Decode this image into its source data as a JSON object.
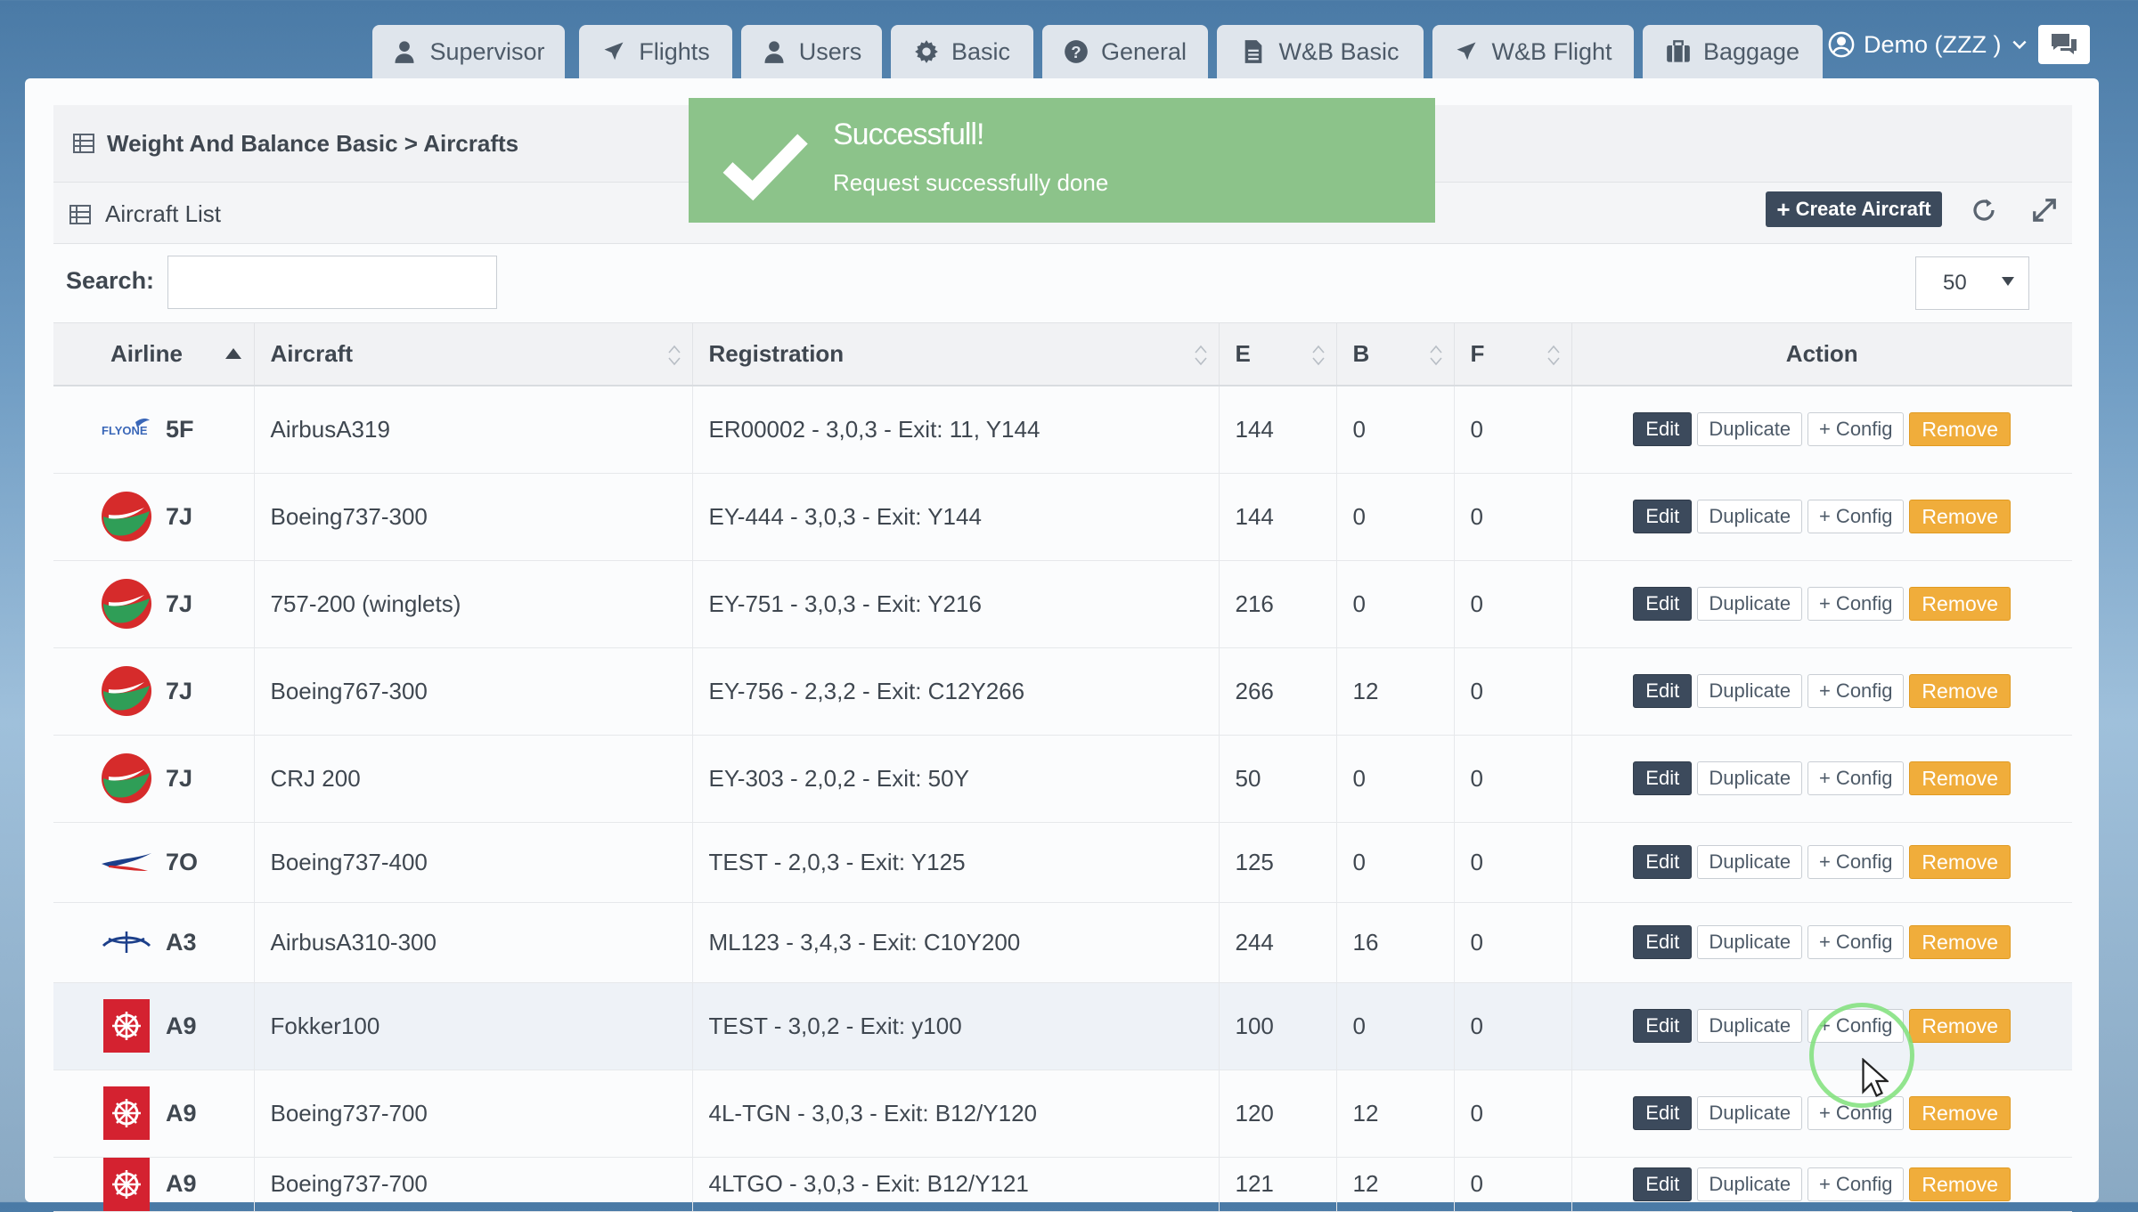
{
  "nav": {
    "tabs": [
      {
        "label": "Supervisor",
        "icon": "user-icon"
      },
      {
        "label": "Flights",
        "icon": "plane-icon"
      },
      {
        "label": "Users",
        "icon": "user-icon"
      },
      {
        "label": "Basic",
        "icon": "gear-icon"
      },
      {
        "label": "General",
        "icon": "question-icon"
      },
      {
        "label": "W&B Basic",
        "icon": "document-icon"
      },
      {
        "label": "W&B Flight",
        "icon": "plane-icon"
      },
      {
        "label": "Baggage",
        "icon": "suitcase-icon"
      }
    ],
    "user_label": "Demo (ZZZ )",
    "chat_icon": "chat-icon"
  },
  "breadcrumb": "Weight And Balance Basic > Aircrafts",
  "list": {
    "title": "Aircraft List",
    "create_label": "Create Aircraft"
  },
  "search": {
    "label": "Search:",
    "value": "",
    "placeholder": ""
  },
  "page_size": "50",
  "toast": {
    "title": "Successfull!",
    "message": "Request successfully done"
  },
  "table": {
    "columns": [
      "Airline",
      "Aircraft",
      "Registration",
      "E",
      "B",
      "F",
      "Action"
    ],
    "actions": {
      "edit": "Edit",
      "duplicate": "Duplicate",
      "config": "+ Config",
      "remove": "Remove"
    },
    "rows": [
      {
        "airline": "5F",
        "logo": "flyone-logo",
        "aircraft": "AirbusA319",
        "registration": "ER00002 - 3,0,3 - Exit: 11, Y144",
        "e": "144",
        "b": "0",
        "f": "0"
      },
      {
        "airline": "7J",
        "logo": "tajik-air-logo",
        "aircraft": "Boeing737-300",
        "registration": "EY-444 - 3,0,3 - Exit: Y144",
        "e": "144",
        "b": "0",
        "f": "0"
      },
      {
        "airline": "7J",
        "logo": "tajik-air-logo",
        "aircraft": "757-200 (winglets)",
        "registration": "EY-751 - 3,0,3 - Exit: Y216",
        "e": "216",
        "b": "0",
        "f": "0"
      },
      {
        "airline": "7J",
        "logo": "tajik-air-logo",
        "aircraft": "Boeing767-300",
        "registration": "EY-756 - 2,3,2 - Exit: C12Y266",
        "e": "266",
        "b": "12",
        "f": "0"
      },
      {
        "airline": "7J",
        "logo": "tajik-air-logo",
        "aircraft": "CRJ 200",
        "registration": "EY-303 - 2,0,2 - Exit: 50Y",
        "e": "50",
        "b": "0",
        "f": "0"
      },
      {
        "airline": "7O",
        "logo": "swoosh-logo",
        "aircraft": "Boeing737-400",
        "registration": "TEST - 2,0,3 - Exit: Y125",
        "e": "125",
        "b": "0",
        "f": "0"
      },
      {
        "airline": "A3",
        "logo": "aegean-logo",
        "aircraft": "AirbusA310-300",
        "registration": "ML123 - 3,4,3 - Exit: C10Y200",
        "e": "244",
        "b": "16",
        "f": "0"
      },
      {
        "airline": "A9",
        "logo": "georgian-logo",
        "aircraft": "Fokker100",
        "registration": "TEST - 3,0,2 - Exit: y100",
        "e": "100",
        "b": "0",
        "f": "0"
      },
      {
        "airline": "A9",
        "logo": "georgian-logo",
        "aircraft": "Boeing737-700",
        "registration": "4L-TGN - 3,0,3 - Exit: B12/Y120",
        "e": "120",
        "b": "12",
        "f": "0"
      },
      {
        "airline": "A9",
        "logo": "georgian-logo",
        "aircraft": "Boeing737-700",
        "registration": "4LTGO - 3,0,3 - Exit: B12/Y121",
        "e": "121",
        "b": "12",
        "f": "0"
      }
    ]
  }
}
